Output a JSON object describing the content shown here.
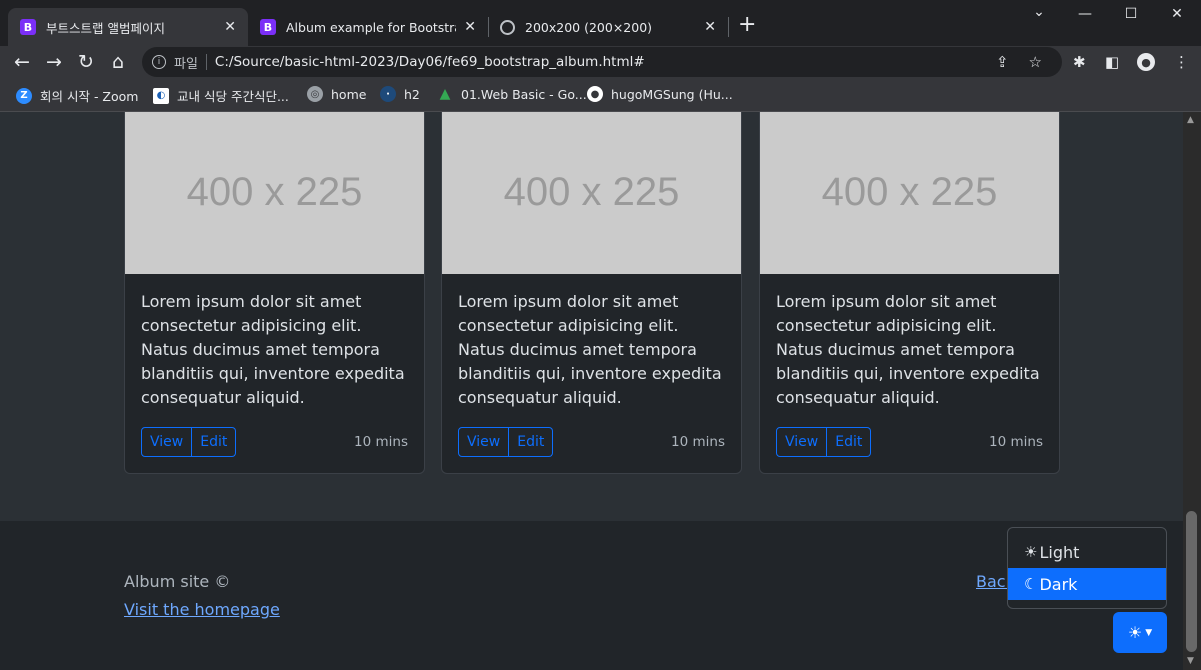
{
  "browser": {
    "tabs": [
      {
        "title": "부트스트랩 앨범페이지",
        "icon": "bootstrap-icon"
      },
      {
        "title": "Album example for Bootstrap",
        "icon": "bootstrap-icon"
      },
      {
        "title": "200x200 (200×200)",
        "icon": "globe-icon"
      }
    ],
    "url_scheme": "파일",
    "url": "C:/Source/basic-html-2023/Day06/fe69_bootstrap_album.html#",
    "bookmarks": [
      {
        "label": "회의 시작 - Zoom",
        "icon": "zoom-icon",
        "color": "#2d8cff"
      },
      {
        "label": "교내 식당 주간식단...",
        "icon": "school-icon",
        "color": "#1a5fb4"
      },
      {
        "label": "home",
        "icon": "globe-icon",
        "color": "#9aa0a6"
      },
      {
        "label": "h2",
        "icon": "h2-database-icon",
        "color": "#1e4a7a"
      },
      {
        "label": "01.Web Basic - Go...",
        "icon": "google-drive-icon",
        "color": "#34a853"
      },
      {
        "label": "hugoMGSung (Hu...",
        "icon": "github-icon",
        "color": "#ffffff"
      }
    ]
  },
  "cards": [
    {
      "image_text": "400 x 225",
      "text": "Lorem ipsum dolor sit amet consectetur adipisicing elit. Natus ducimus amet tempora blanditiis qui, inventore expedita consequatur aliquid.",
      "view_label": "View",
      "edit_label": "Edit",
      "time": "10 mins"
    },
    {
      "image_text": "400 x 225",
      "text": "Lorem ipsum dolor sit amet consectetur adipisicing elit. Natus ducimus amet tempora blanditiis qui, inventore expedita consequatur aliquid.",
      "view_label": "View",
      "edit_label": "Edit",
      "time": "10 mins"
    },
    {
      "image_text": "400 x 225",
      "text": "Lorem ipsum dolor sit amet consectetur adipisicing elit. Natus ducimus amet tempora blanditiis qui, inventore expedita consequatur aliquid.",
      "view_label": "View",
      "edit_label": "Edit",
      "time": "10 mins"
    }
  ],
  "footer": {
    "copyright": "Album site ©",
    "homepage_link": "Visit the homepage",
    "back_link": "Back"
  },
  "theme_menu": {
    "items": [
      {
        "label": "Light",
        "icon": "sun-icon",
        "active": false
      },
      {
        "label": "Dark",
        "icon": "moon-stars-icon",
        "active": true
      }
    ],
    "button_icon": "sun-icon"
  },
  "colors": {
    "accent": "#0d6efd",
    "link": "#6ea8fe",
    "page_bg": "#2b3035",
    "card_bg": "#212529"
  }
}
